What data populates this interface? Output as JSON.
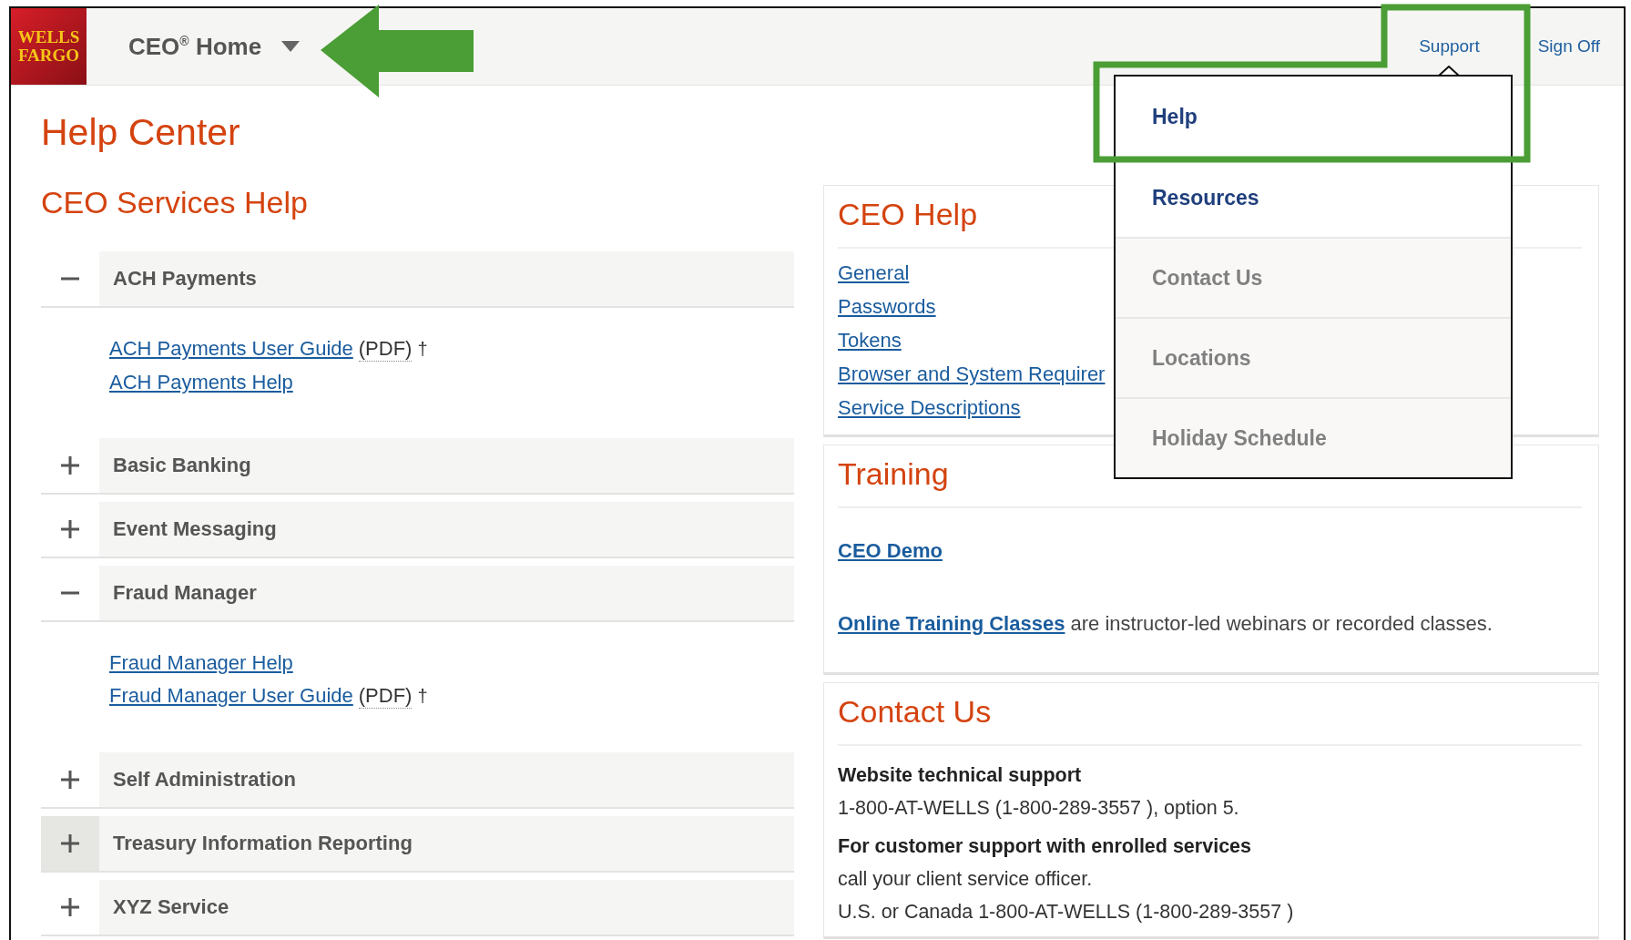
{
  "header": {
    "logo": [
      "WELLS",
      "FARGO"
    ],
    "home_menu": "CEO$^{®}$ Home",
    "links": [
      "Support",
      "Sign Off"
    ]
  },
  "support_menu": [
    {
      "label": "Help",
      "emphasis": true
    },
    {
      "label": "Resources",
      "emphasis": true
    },
    {
      "label": "Contact Us",
      "emphasis": false
    },
    {
      "label": "Locations",
      "emphasis": false
    },
    {
      "label": "Holiday Schedule",
      "emphasis": false
    }
  ],
  "page_title": "Help Center",
  "services": {
    "title": "CEO Services Help",
    "sections": [
      {
        "label": "ACH Payments",
        "expanded": true,
        "hovered": false,
        "links": [
          {
            "label": "ACH Payments User Guide",
            "format": "(PDF)",
            "mark": "†"
          },
          {
            "label": "ACH Payments Help"
          }
        ]
      },
      {
        "label": "Basic Banking",
        "expanded": false,
        "hovered": false
      },
      {
        "label": "Event Messaging",
        "expanded": false,
        "hovered": false
      },
      {
        "label": "Fraud Manager",
        "expanded": true,
        "hovered": false,
        "links": [
          {
            "label": "Fraud Manager Help"
          },
          {
            "label": "Fraud Manager User Guide",
            "format": "(PDF)",
            "mark": "†"
          }
        ]
      },
      {
        "label": "Self Administration",
        "expanded": false,
        "hovered": false
      },
      {
        "label": "Treasury Information Reporting",
        "expanded": false,
        "hovered": true
      },
      {
        "label": "XYZ Service",
        "expanded": false,
        "hovered": false
      }
    ]
  },
  "ceo_help": {
    "title": "CEO Help",
    "links": [
      "General",
      "Passwords",
      "Tokens",
      "Browser and System Requirer",
      "Service Descriptions"
    ]
  },
  "training": {
    "title": "Training",
    "demo_link": "CEO Demo",
    "classes_link": "Online Training Classes",
    "classes_text": " are instructor-led webinars or recorded classes."
  },
  "contact": {
    "title": "Contact Us",
    "lines": [
      {
        "kind": "heading",
        "text": "Website technical support"
      },
      {
        "kind": "text",
        "text": "1-800-AT-WELLS  (1-800-289-3557 ), option 5."
      },
      {
        "kind": "heading",
        "text": "For customer support with enrolled services"
      },
      {
        "kind": "text",
        "text": "call your client service officer."
      },
      {
        "kind": "text",
        "text": "U.S. or Canada 1-800-AT-WELLS (1-800-289-3557 )"
      }
    ]
  }
}
